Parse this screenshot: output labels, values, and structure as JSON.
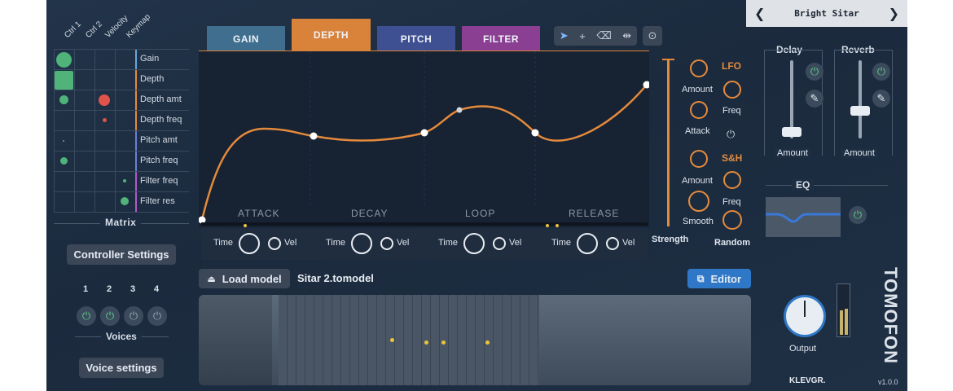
{
  "preset": {
    "name": "Bright Sitar",
    "prev_icon": "chevron-left-icon",
    "next_icon": "chevron-right-icon"
  },
  "matrix": {
    "title": "Matrix",
    "columns": [
      "Ctrl 1",
      "Ctrl 2",
      "Velocity",
      "Keymap"
    ],
    "rows": [
      {
        "label": "Gain",
        "color": "#6aa8d8"
      },
      {
        "label": "Depth",
        "color": "#e48a3c"
      },
      {
        "label": "Depth amt",
        "color": "#e48a3c"
      },
      {
        "label": "Depth freq",
        "color": "#e48a3c"
      },
      {
        "label": "Pitch amt",
        "color": "#6a7fd8"
      },
      {
        "label": "Pitch freq",
        "color": "#6a7fd8"
      },
      {
        "label": "Filter freq",
        "color": "#b05cc8"
      },
      {
        "label": "Filter res",
        "color": "#b05cc8"
      }
    ]
  },
  "controller_settings_label": "Controller Settings",
  "voices": {
    "title": "Voices",
    "numbers": [
      "1",
      "2",
      "3",
      "4"
    ],
    "settings_label": "Voice settings"
  },
  "tabs": [
    {
      "label": "GAIN",
      "color": "#3f6e8f"
    },
    {
      "label": "DEPTH",
      "color": "#d9823a"
    },
    {
      "label": "PITCH",
      "color": "#3e4f92"
    },
    {
      "label": "FILTER",
      "color": "#8a3f93"
    }
  ],
  "toolbar": {
    "icons": [
      "cursor-icon",
      "plus-icon",
      "erase-icon",
      "split-icon",
      "snap-icon"
    ]
  },
  "envelope": {
    "segments": [
      "ATTACK",
      "DECAY",
      "LOOP",
      "RELEASE"
    ],
    "time_label": "Time",
    "vel_label": "Vel"
  },
  "lfo": {
    "title": "LFO",
    "amount_label": "Amount",
    "freq_label": "Freq",
    "attack_label": "Attack"
  },
  "sh": {
    "title": "S&H",
    "amount_label": "Amount",
    "freq_label": "Freq",
    "smooth_label": "Smooth",
    "random_label": "Random"
  },
  "strength_label": "Strength",
  "model": {
    "load_label": "Load model",
    "file_name": "Sitar 2.tomodel",
    "editor_label": "Editor"
  },
  "effects": {
    "delay": {
      "title": "Delay",
      "amount_label": "Amount",
      "level": 0.22
    },
    "reverb": {
      "title": "Reverb",
      "amount_label": "Amount",
      "level": 0.55
    },
    "eq_title": "EQ"
  },
  "output": {
    "label": "Output"
  },
  "brand": {
    "logo": "TOMOFON",
    "vendor": "KLEVGR.",
    "version": "v1.0.0"
  }
}
